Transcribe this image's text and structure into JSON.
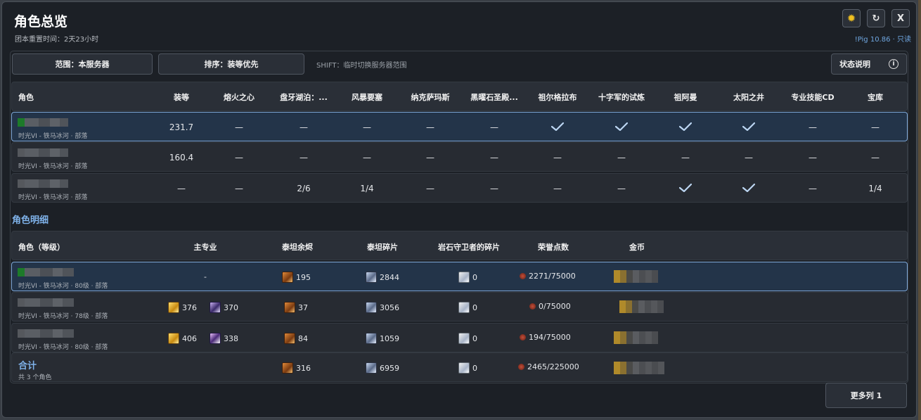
{
  "window": {
    "title": "角色总览",
    "reset_time": "团本重置时间：2天23小时",
    "version": "!Pig 10.86 · 只读",
    "close_label": "X"
  },
  "toolbar": {
    "scope_label": "范围：本服务器",
    "sort_label": "排序：装等优先",
    "shift_hint": "SHIFT：临时切换服务器范围",
    "status_label": "状态说明"
  },
  "overview": {
    "columns": [
      "角色",
      "装等",
      "熔火之心",
      "盘牙湖泊：...",
      "风暴要塞",
      "纳克萨玛斯",
      "黑曜石圣殿...",
      "祖尔格拉布",
      "十字军的试炼",
      "祖阿曼",
      "太阳之井",
      "专业技能CD",
      "宝库"
    ],
    "rows": [
      {
        "sub": "时光VI - 铁马冰河 · 部落",
        "ilvl": "231.7",
        "cells": [
          "—",
          "—",
          "—",
          "—",
          "—",
          "check",
          "check",
          "check",
          "check",
          "—",
          "—"
        ]
      },
      {
        "sub": "时光VI - 铁马冰河 · 部落",
        "ilvl": "160.4",
        "cells": [
          "—",
          "—",
          "—",
          "—",
          "—",
          "—",
          "—",
          "—",
          "—",
          "—",
          "—"
        ]
      },
      {
        "sub": "时光VI - 铁马冰河 · 部落",
        "ilvl": "—",
        "cells": [
          "—",
          "2/6",
          "1/4",
          "—",
          "—",
          "—",
          "—",
          "check",
          "check",
          "—",
          "1/4"
        ]
      }
    ]
  },
  "details": {
    "section_title": "角色明细",
    "columns": [
      "角色（等级）",
      "主专业",
      "泰坦余烬",
      "泰坦碎片",
      "岩石守卫者的碎片",
      "荣誉点数",
      "金币"
    ],
    "rows": [
      {
        "sub": "时光VI - 铁马冰河 · 80级 · 部落",
        "prof": "-",
        "prof1": "",
        "prof2": "",
        "ember": "195",
        "shard": "2844",
        "stone": "0",
        "honor": "2271/75000"
      },
      {
        "sub": "时光VI - 铁马冰河 · 78级 · 部落",
        "prof": "",
        "prof1": "376",
        "prof2": "370",
        "ember": "37",
        "shard": "3056",
        "stone": "0",
        "honor": "0/75000"
      },
      {
        "sub": "时光VI - 铁马冰河 · 80级 · 部落",
        "prof": "",
        "prof1": "406",
        "prof2": "338",
        "ember": "84",
        "shard": "1059",
        "stone": "0",
        "honor": "194/75000"
      }
    ],
    "total": {
      "label": "合计",
      "sub": "共 3 个角色",
      "ember": "316",
      "shard": "6959",
      "stone": "0",
      "honor": "2465/225000"
    }
  },
  "footer": {
    "more_label": "更多列 1"
  },
  "colors": {
    "accent": "#7fb2ea",
    "selected_row": "#233449",
    "gear": "#f0c020"
  }
}
